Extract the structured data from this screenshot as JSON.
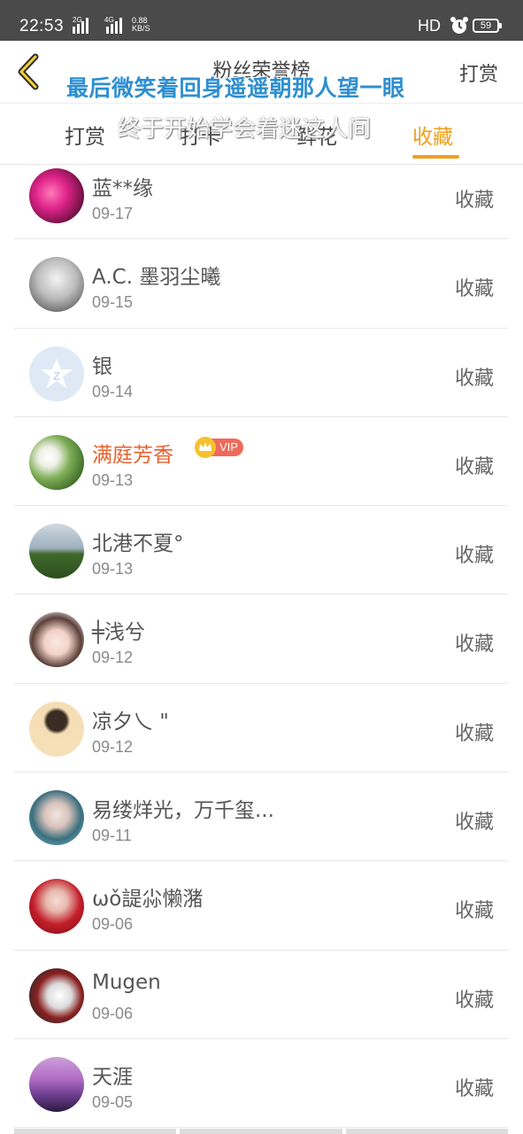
{
  "status_bar": {
    "time": "22:53",
    "signal1_tag": "2G",
    "signal2_tag": "4G",
    "speed_value": "0.88",
    "speed_unit": "KB/S",
    "hd": "HD",
    "battery": "59"
  },
  "header": {
    "title": "粉丝荣誉榜",
    "right_label": "打赏"
  },
  "overlay": {
    "line1": "最后微笑着回身遥遥朝那人望一眼",
    "line2": "终于开始学会着迷这人间"
  },
  "tabs": [
    {
      "label": "打赏"
    },
    {
      "label": "打卡"
    },
    {
      "label": "鲜花"
    },
    {
      "label": "收藏"
    }
  ],
  "active_tab": "收藏",
  "colors": {
    "accent": "#f0a01c",
    "vip_name": "#e8602c",
    "overlay_blue": "#2e8fd0"
  },
  "list": [
    {
      "name": "蓝**缘",
      "date": "09-17",
      "action": "收藏",
      "vip": false
    },
    {
      "name": "A.C. 墨羽尘曦",
      "date": "09-15",
      "action": "收藏",
      "vip": false
    },
    {
      "name": "银",
      "date": "09-14",
      "action": "收藏",
      "vip": false
    },
    {
      "name": "满庭芳香",
      "date": "09-13",
      "action": "收藏",
      "vip": true,
      "vip_label": "VIP"
    },
    {
      "name": "北港不夏°",
      "date": "09-13",
      "action": "收藏",
      "vip": false
    },
    {
      "name": "╪浅兮",
      "date": "09-12",
      "action": "收藏",
      "vip": false
    },
    {
      "name": "凉夕乀 \"",
      "date": "09-12",
      "action": "收藏",
      "vip": false
    },
    {
      "name": "易缕烊光，万千玺...",
      "date": "09-11",
      "action": "收藏",
      "vip": false
    },
    {
      "name": "ωǒ諟尛懒潴",
      "date": "09-06",
      "action": "收藏",
      "vip": false
    },
    {
      "name": "Mugen",
      "date": "09-06",
      "action": "收藏",
      "vip": false
    },
    {
      "name": "天涯",
      "date": "09-05",
      "action": "收藏",
      "vip": false
    }
  ]
}
